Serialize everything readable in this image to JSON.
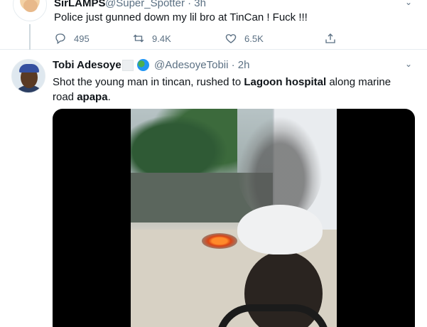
{
  "tweet_top": {
    "name": "SirLAMPS",
    "handle": "@Super_Spotter · 3h",
    "text": "Police just gunned down my lil bro at TinCan ! Fuck !!!",
    "replies": "495",
    "retweets": "9.4K",
    "likes": "6.5K"
  },
  "tweet_main": {
    "name": "Tobi Adesoye",
    "handle": "@AdesoyeTobii · 2h",
    "text_part1": "Shot the young man in tincan, rushed to ",
    "text_bold1": "Lagoon hospital",
    "text_part2": " along marine road ",
    "text_bold2": "apapa",
    "text_part3": "."
  },
  "icons": {
    "reply": "reply-icon",
    "retweet": "retweet-icon",
    "like": "heart-icon",
    "share": "share-icon",
    "more": "chevron-down-icon",
    "globe": "globe-icon"
  },
  "colors": {
    "secondary_text": "#5b7083",
    "divider": "#e6ecf0"
  }
}
